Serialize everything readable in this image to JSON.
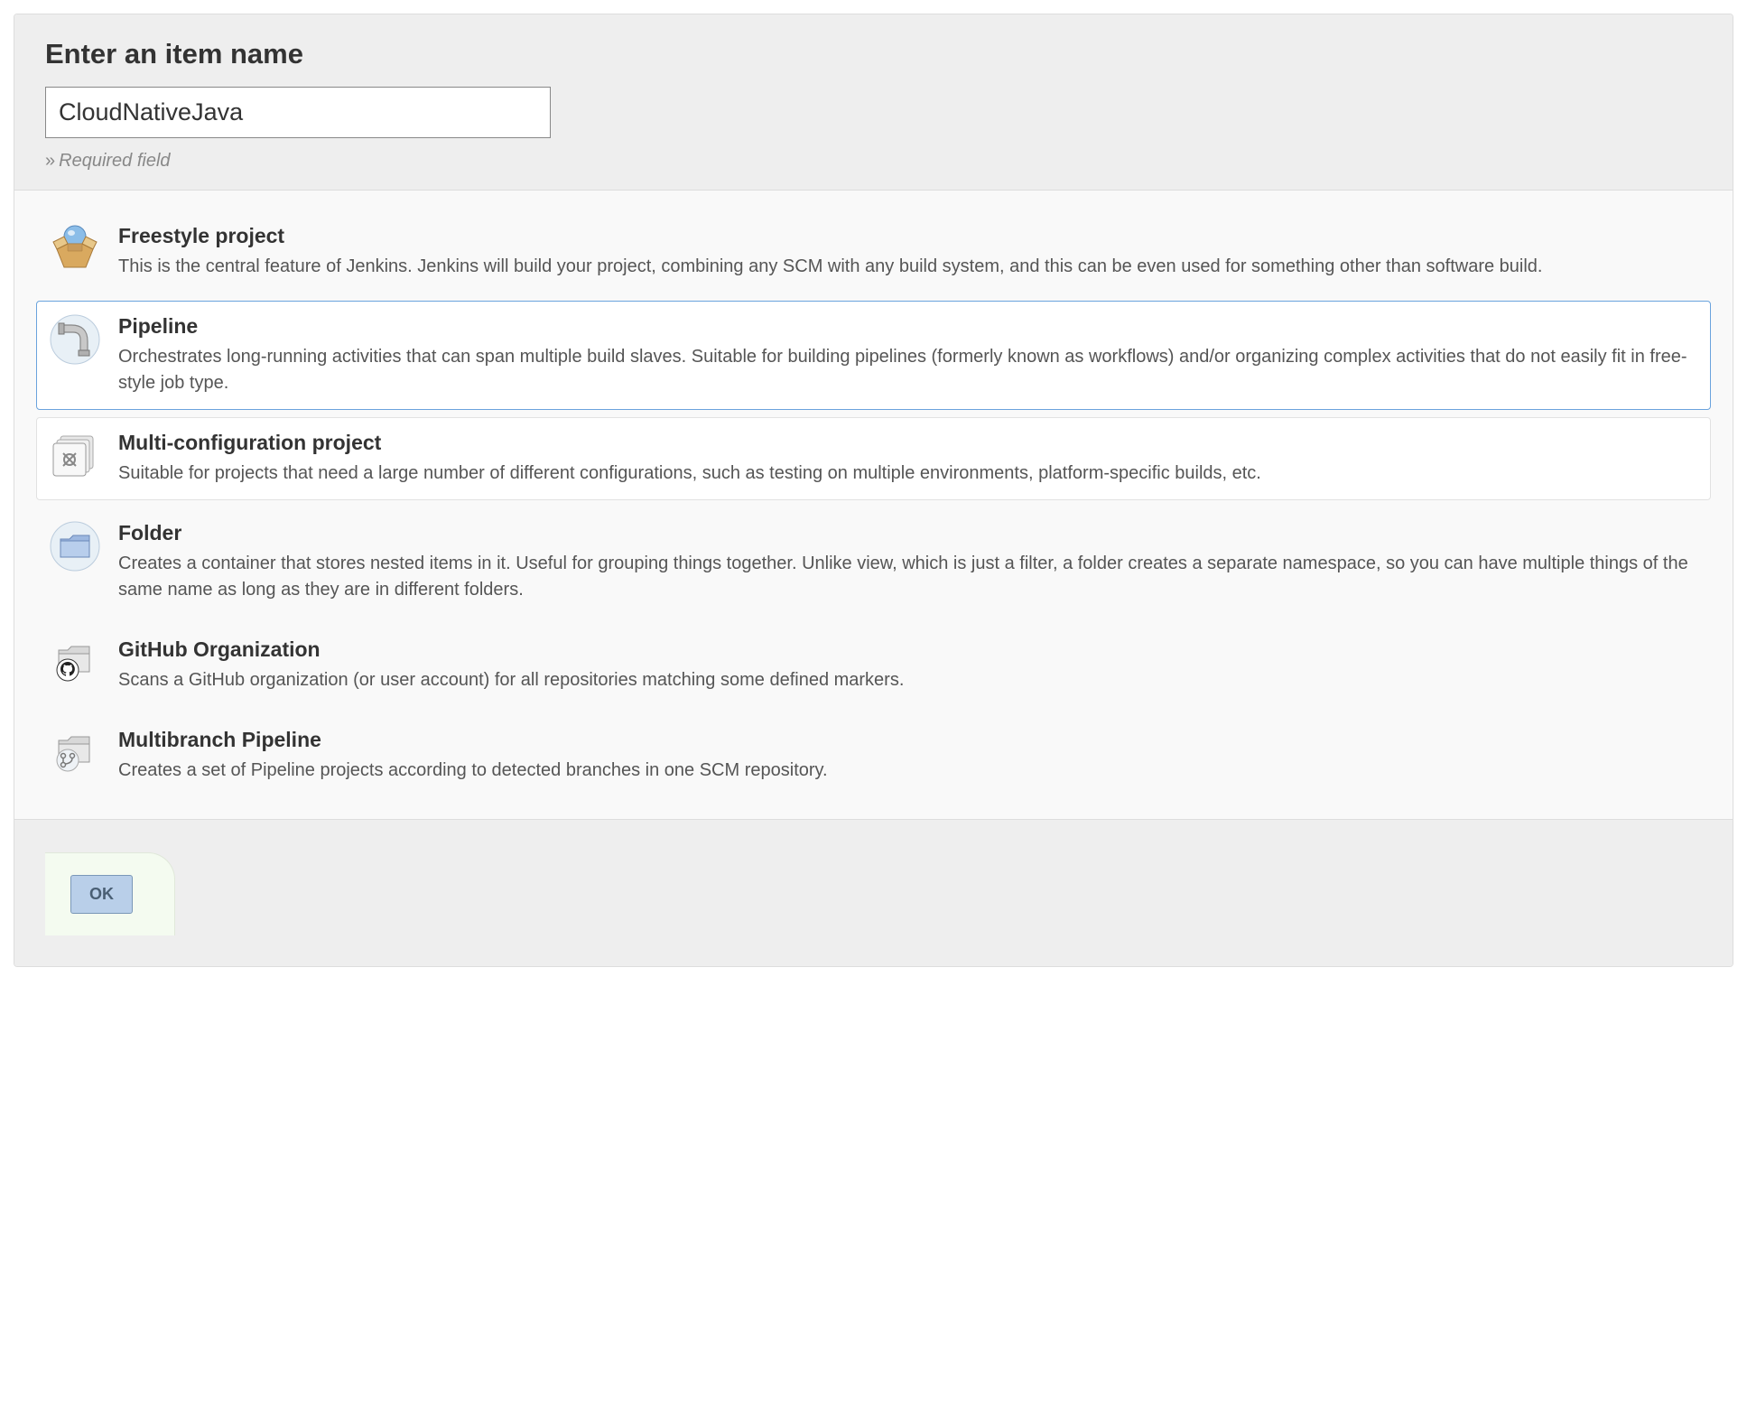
{
  "header": {
    "title": "Enter an item name",
    "input_value": "CloudNativeJava",
    "required_note": "Required field"
  },
  "items": [
    {
      "icon": "box-open",
      "title": "Freestyle project",
      "desc": "This is the central feature of Jenkins. Jenkins will build your project, combining any SCM with any build system, and this can be even used for something other than software build.",
      "selected": false,
      "bordered": false
    },
    {
      "icon": "pipe-elbow",
      "title": "Pipeline",
      "desc": "Orchestrates long-running activities that can span multiple build slaves. Suitable for building pipelines (formerly known as workflows) and/or organizing complex activities that do not easily fit in free-style job type.",
      "selected": true,
      "bordered": false
    },
    {
      "icon": "multi-folders",
      "title": "Multi-configuration project",
      "desc": "Suitable for projects that need a large number of different configurations, such as testing on multiple environments, platform-specific builds, etc.",
      "selected": false,
      "bordered": true
    },
    {
      "icon": "folder",
      "title": "Folder",
      "desc": "Creates a container that stores nested items in it. Useful for grouping things together. Unlike view, which is just a filter, a folder creates a separate namespace, so you can have multiple things of the same name as long as they are in different folders.",
      "selected": false,
      "bordered": false
    },
    {
      "icon": "github-folder",
      "title": "GitHub Organization",
      "desc": "Scans a GitHub organization (or user account) for all repositories matching some defined markers.",
      "selected": false,
      "bordered": false
    },
    {
      "icon": "branch-folder",
      "title": "Multibranch Pipeline",
      "desc": "Creates a set of Pipeline projects according to detected branches in one SCM repository.",
      "selected": false,
      "bordered": false
    }
  ],
  "footer": {
    "ok_label": "OK"
  }
}
